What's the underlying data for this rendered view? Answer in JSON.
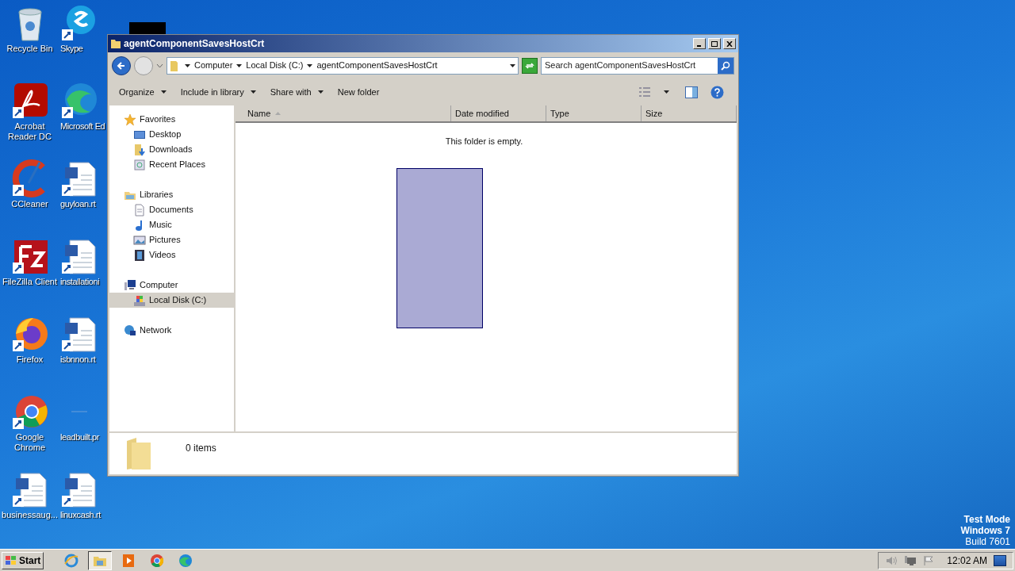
{
  "desktop_icons": [
    {
      "label": "Recycle Bin",
      "kind": "recycle"
    },
    {
      "label": "Skype",
      "kind": "skype"
    },
    {
      "label": "Acrobat Reader DC",
      "kind": "acrobat"
    },
    {
      "label": "Microsoft Ed",
      "kind": "edge"
    },
    {
      "label": "CCleaner",
      "kind": "ccleaner"
    },
    {
      "label": "guyloan.rt",
      "kind": "word"
    },
    {
      "label": "FileZilla Client",
      "kind": "filezilla"
    },
    {
      "label": "installationi",
      "kind": "word"
    },
    {
      "label": "Firefox",
      "kind": "firefox"
    },
    {
      "label": "isbnnon.rt",
      "kind": "word"
    },
    {
      "label": "Google Chrome",
      "kind": "chrome"
    },
    {
      "label": "leadbuilt.pr",
      "kind": "blank"
    },
    {
      "label": "businessaug...",
      "kind": "word"
    },
    {
      "label": "linuxcash.rt",
      "kind": "word"
    }
  ],
  "window": {
    "title": "agentComponentSavesHostCrt",
    "breadcrumb": [
      "Computer",
      "Local Disk (C:)",
      "agentComponentSavesHostCrt"
    ],
    "search": {
      "placeholder": "Search agentComponentSavesHostCrt"
    },
    "toolbar": [
      {
        "label": "Organize",
        "dropdown": true
      },
      {
        "label": "Include in library",
        "dropdown": true
      },
      {
        "label": "Share with",
        "dropdown": true
      },
      {
        "label": "New folder",
        "dropdown": false
      }
    ],
    "nav_pane": [
      {
        "label": "Favorites",
        "kind": "star",
        "selected": false,
        "children": [
          {
            "label": "Desktop",
            "kind": "desktop",
            "selected": false
          },
          {
            "label": "Downloads",
            "kind": "downloads",
            "selected": false
          },
          {
            "label": "Recent Places",
            "kind": "recent",
            "selected": false
          }
        ]
      },
      {
        "label": "Libraries",
        "kind": "libraries",
        "selected": false,
        "children": [
          {
            "label": "Documents",
            "kind": "documents",
            "selected": false
          },
          {
            "label": "Music",
            "kind": "music",
            "selected": false
          },
          {
            "label": "Pictures",
            "kind": "pictures",
            "selected": false
          },
          {
            "label": "Videos",
            "kind": "videos",
            "selected": false
          }
        ]
      },
      {
        "label": "Computer",
        "kind": "computer",
        "selected": false,
        "children": [
          {
            "label": "Local Disk (C:)",
            "kind": "disk",
            "selected": true
          }
        ]
      },
      {
        "label": "Network",
        "kind": "network",
        "selected": false
      }
    ],
    "columns": [
      {
        "label": "Name",
        "sorted": true
      },
      {
        "label": "Date modified",
        "sorted": false
      },
      {
        "label": "Type",
        "sorted": false
      },
      {
        "label": "Size",
        "sorted": false
      }
    ],
    "empty_message": "This folder is empty.",
    "details": "0 items"
  },
  "system_notice": [
    "Test Mode",
    "Windows 7",
    "Build 7601"
  ],
  "taskbar": {
    "start": "Start",
    "apps": [
      {
        "kind": "ie",
        "selected": false
      },
      {
        "kind": "explorer",
        "selected": true
      },
      {
        "kind": "media",
        "selected": false
      },
      {
        "kind": "chrome",
        "selected": false
      },
      {
        "kind": "edge",
        "selected": false
      }
    ],
    "clock": "12:02 AM"
  }
}
